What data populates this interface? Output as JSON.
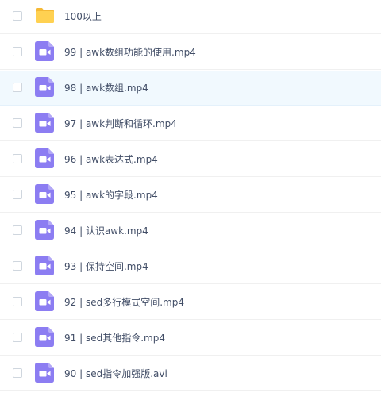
{
  "files": [
    {
      "name": "100以上",
      "type": "folder",
      "hovered": false
    },
    {
      "name": "99 | awk数组功能的使用.mp4",
      "type": "video",
      "hovered": false
    },
    {
      "name": "98 | awk数组.mp4",
      "type": "video",
      "hovered": true
    },
    {
      "name": "97 | awk判断和循环.mp4",
      "type": "video",
      "hovered": false
    },
    {
      "name": "96 | awk表达式.mp4",
      "type": "video",
      "hovered": false
    },
    {
      "name": "95 | awk的字段.mp4",
      "type": "video",
      "hovered": false
    },
    {
      "name": "94 | 认识awk.mp4",
      "type": "video",
      "hovered": false
    },
    {
      "name": "93 | 保持空间.mp4",
      "type": "video",
      "hovered": false
    },
    {
      "name": "92 | sed多行模式空间.mp4",
      "type": "video",
      "hovered": false
    },
    {
      "name": "91 | sed其他指令.mp4",
      "type": "video",
      "hovered": false
    },
    {
      "name": "90 | sed指令加强版.avi",
      "type": "video",
      "hovered": false
    }
  ],
  "colors": {
    "folder": "#ffd151",
    "folder_tab": "#f5b935",
    "video": "#8c7df2",
    "text": "#424e67",
    "hover_bg": "#f1f9fe"
  },
  "icons": {
    "folder": "folder-icon",
    "video": "video-file-icon"
  }
}
